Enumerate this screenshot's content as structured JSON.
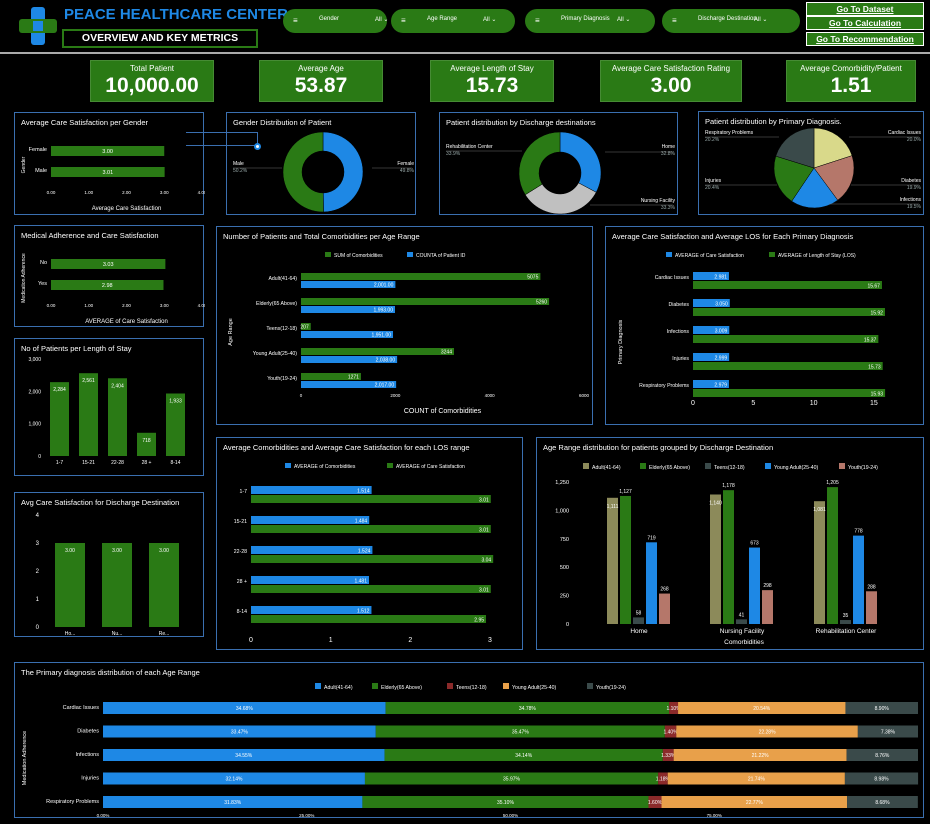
{
  "header": {
    "title": "PEACE HEALTHCARE CENTER",
    "subtitle": "OVERVIEW AND KEY METRICS",
    "filters": [
      {
        "label": "Gender",
        "value": "All"
      },
      {
        "label": "Age Range",
        "value": "All"
      },
      {
        "label": "Primary Diagnosis",
        "value": "All"
      },
      {
        "label": "Discharge Destination",
        "value": "All"
      }
    ],
    "nav": [
      "Go To Dataset",
      "Go To Calculation",
      "Go To Recommendation"
    ]
  },
  "kpis": [
    {
      "label": "Total Patient",
      "value": "10,000.00"
    },
    {
      "label": "Average Age",
      "value": "53.87"
    },
    {
      "label": "Average Length of Stay",
      "value": "15.73"
    },
    {
      "label": "Average Care Satisfaction Rating",
      "value": "3.00"
    },
    {
      "label": "Average Comorbidity/Patient",
      "value": "1.51"
    }
  ],
  "colors": {
    "green": "#2a7a15",
    "blue": "#1e88e5",
    "grey": "#c0c0c0",
    "olive": "#8c8a5a",
    "darkslate": "#3a4a4a",
    "salmon": "#b5776a",
    "yellow": "#d9d98a",
    "maroon": "#8b2a2a",
    "orange": "#e8a04a"
  },
  "chart_data": [
    {
      "id": "c1",
      "type": "bar",
      "orientation": "horizontal",
      "title": "Average Care Satisfaction per Gender",
      "categories": [
        "Female",
        "Male"
      ],
      "values": [
        3.0,
        3.01
      ],
      "labels": [
        "3.00",
        "3.01"
      ],
      "xlabel": "Average Care Satisfaction",
      "ylabel": "Gender",
      "xlim": [
        0,
        4
      ],
      "ticks": [
        "0.00",
        "1.00",
        "2.00",
        "3.00",
        "4.00"
      ]
    },
    {
      "id": "c2",
      "type": "pie",
      "donut": true,
      "title": "Gender Distribution of Patient",
      "slices": [
        {
          "name": "Female",
          "value": 49.8,
          "pct": "49.8%"
        },
        {
          "name": "Male",
          "value": 50.2,
          "pct": "50.2%"
        }
      ]
    },
    {
      "id": "c3",
      "type": "pie",
      "donut": true,
      "title": "Patient distribution by Discharge destinations",
      "slices": [
        {
          "name": "Home",
          "value": 32.8,
          "pct": "32.8%"
        },
        {
          "name": "Nursing Facility",
          "value": 33.3,
          "pct": "33.3%"
        },
        {
          "name": "Rehabilitation Center",
          "value": 33.9,
          "pct": "33.9%"
        }
      ]
    },
    {
      "id": "c4",
      "type": "pie",
      "donut": false,
      "title": "Patient distribution by Primary Diagnosis.",
      "slices": [
        {
          "name": "Cardiac Issues",
          "value": 20.0,
          "pct": "20.0%"
        },
        {
          "name": "Diabetes",
          "value": 19.9,
          "pct": "19.9%"
        },
        {
          "name": "Infections",
          "value": 19.5,
          "pct": "19.5%"
        },
        {
          "name": "Injuries",
          "value": 20.4,
          "pct": "20.4%"
        },
        {
          "name": "Respiratory Problems",
          "value": 20.2,
          "pct": "20.2%"
        }
      ]
    },
    {
      "id": "c5",
      "type": "bar",
      "orientation": "horizontal",
      "title": "Medical Adherence and Care Satisfaction",
      "categories": [
        "No",
        "Yes"
      ],
      "values": [
        3.03,
        2.98
      ],
      "labels": [
        "3.03",
        "2.98"
      ],
      "xlabel": "AVERAGE of Care Satisfaction",
      "ylabel": "Medication Adherence",
      "xlim": [
        0,
        4
      ],
      "ticks": [
        "0.00",
        "1.00",
        "2.00",
        "3.00",
        "4.00"
      ]
    },
    {
      "id": "c6",
      "type": "bar",
      "orientation": "horizontal",
      "title": "Number of Patients and Total Comorbidities per Age Range",
      "categories": [
        "Adult(41-64)",
        "Elderly(65 Above)",
        "Teens(12-18)",
        "Young Adult(25-40)",
        "Youth(19-24)"
      ],
      "series": [
        {
          "name": "SUM of Comorbidities",
          "values": [
            5075,
            5260,
            207,
            3244,
            1271
          ],
          "labels": [
            "5075",
            "5260",
            "207",
            "3244",
            "1271"
          ]
        },
        {
          "name": "COUNTA of Patient ID",
          "values": [
            2001,
            1993,
            1951,
            2038,
            2017
          ],
          "labels": [
            "2,001.00",
            "1,993.00",
            "1,951.00",
            "2,038.00",
            "2,017.00"
          ]
        }
      ],
      "xlabel": "COUNT of Comorbidities",
      "ylabel": "Age Range",
      "xlim": [
        0,
        6000
      ],
      "ticks": [
        "0",
        "2000",
        "4000",
        "6000"
      ]
    },
    {
      "id": "c7",
      "type": "bar",
      "orientation": "horizontal",
      "title": "Average Care Satisfaction and Average LOS for Each Primary Diagnosis",
      "categories": [
        "Cardiac Issues",
        "Diabetes",
        "Infections",
        "Injuries",
        "Respiratory Problems"
      ],
      "series": [
        {
          "name": "AVERAGE of Care Satisfaction",
          "values": [
            2.981,
            3.05,
            3.009,
            2.999,
            2.979
          ],
          "labels": [
            "2.981",
            "3.050",
            "3.009",
            "2.999",
            "2.979"
          ]
        },
        {
          "name": "AVERAGE of Length of Stay (LOS)",
          "values": [
            15.67,
            15.92,
            15.37,
            15.73,
            15.93
          ],
          "labels": [
            "15.67",
            "15.92",
            "15.37",
            "15.73",
            "15.93"
          ]
        }
      ],
      "ylabel": "Primary Diagnosis",
      "xlim": [
        0,
        17
      ],
      "ticks": [
        "0",
        "5",
        "10",
        "15"
      ],
      "tickvals": [
        0,
        5,
        10,
        15
      ]
    },
    {
      "id": "c8",
      "type": "bar",
      "orientation": "vertical",
      "title": "No of Patients per Length of Stay",
      "categories": [
        "1-7",
        "15-21",
        "22-28",
        "28 +",
        "8-14"
      ],
      "values": [
        2284,
        2561,
        2404,
        718,
        1933
      ],
      "labels": [
        "2,284",
        "2,561",
        "2,404",
        "718",
        "1,933"
      ],
      "ylim": [
        0,
        3000
      ],
      "ticks": [
        "0",
        "1,000",
        "2,000",
        "3,000"
      ]
    },
    {
      "id": "c9",
      "type": "bar",
      "orientation": "vertical",
      "title": "Avg Care Satisfaction for Discharge Destination",
      "categories": [
        "Ho...",
        "Nu...",
        "Re..."
      ],
      "values": [
        3.0,
        3.0,
        3.0
      ],
      "labels": [
        "3.00",
        "3.00",
        "3.00"
      ],
      "ylim": [
        0,
        4
      ],
      "ticks": [
        "0",
        "1",
        "2",
        "3",
        "4"
      ]
    },
    {
      "id": "c10",
      "type": "bar",
      "orientation": "horizontal",
      "title": "Average Comorbidities and Average Care Satisfaction for each LOS range",
      "categories": [
        "1-7",
        "15-21",
        "22-28",
        "28 +",
        "8-14"
      ],
      "series": [
        {
          "name": "AVERAGE of Comorbidities",
          "values": [
            1.514,
            1.484,
            1.524,
            1.481,
            1.512
          ],
          "labels": [
            "1.514",
            "1.484",
            "1.524",
            "1.481",
            "1.512"
          ]
        },
        {
          "name": "AVERAGE of Care Satisfaction",
          "values": [
            3.01,
            3.01,
            3.04,
            3.01,
            2.95
          ],
          "labels": [
            "3.01",
            "3.01",
            "3.04",
            "3.01",
            "2.95"
          ]
        }
      ],
      "xlim": [
        0,
        3
      ],
      "ticks": [
        "0",
        "1",
        "2",
        "3"
      ]
    },
    {
      "id": "c11",
      "type": "bar",
      "orientation": "vertical",
      "title": "Age Range distribution for patients grouped by Discharge Destination",
      "categories": [
        "Home",
        "Nursing Facility",
        "Rehabilitation Center"
      ],
      "series": [
        {
          "name": "Adult(41-64)",
          "values": [
            1111,
            1140,
            1081
          ],
          "labels": [
            "1,111",
            "1,140",
            "1,081"
          ]
        },
        {
          "name": "Elderly(65 Above)",
          "values": [
            1127,
            1178,
            1205
          ],
          "labels": [
            "1,127",
            "1,178",
            "1,205"
          ]
        },
        {
          "name": "Teens(12-18)",
          "values": [
            58,
            41,
            35
          ],
          "labels": [
            "58",
            "41",
            "35"
          ]
        },
        {
          "name": "Young Adult(25-40)",
          "values": [
            719,
            673,
            778
          ],
          "labels": [
            "719",
            "673",
            "778"
          ]
        },
        {
          "name": "Youth(19-24)",
          "values": [
            268,
            298,
            288
          ],
          "labels": [
            "268",
            "298",
            "288"
          ]
        }
      ],
      "xlabel": "Comorbidities",
      "ylim": [
        0,
        1250
      ],
      "ticks": [
        "0",
        "250",
        "500",
        "750",
        "1,000",
        "1,250"
      ]
    },
    {
      "id": "c12",
      "type": "bar",
      "orientation": "horizontal",
      "stacked": "percent",
      "title": "The Primary diagnosis distribution of each Age Range",
      "categories": [
        "Cardiac Issues",
        "Diabetes",
        "Infections",
        "Injuries",
        "Respiratory Problems"
      ],
      "series": [
        {
          "name": "Adult(41-64)",
          "values": [
            34.68,
            33.47,
            34.55,
            32.14,
            31.83
          ],
          "labels": [
            "34.68%",
            "33.47%",
            "34.55%",
            "32.14%",
            "31.83%"
          ]
        },
        {
          "name": "Elderly(65 Above)",
          "values": [
            34.78,
            35.47,
            34.14,
            35.97,
            35.1
          ],
          "labels": [
            "34.78%",
            "35.47%",
            "34.14%",
            "35.97%",
            "35.10%"
          ]
        },
        {
          "name": "Teens(12-18)",
          "values": [
            1.1,
            1.4,
            1.33,
            1.18,
            1.6
          ],
          "labels": [
            "1.10%",
            "1.40%",
            "1.33%",
            "1.18%",
            "1.60%"
          ]
        },
        {
          "name": "Young Adult(25-40)",
          "values": [
            20.54,
            22.28,
            21.22,
            21.74,
            22.77
          ],
          "labels": [
            "20.54%",
            "22.28%",
            "21.22%",
            "21.74%",
            "22.77%"
          ]
        },
        {
          "name": "Youth(19-24)",
          "values": [
            8.9,
            7.38,
            8.76,
            8.98,
            8.68
          ],
          "labels": [
            "8.90%",
            "7.38%",
            "8.76%",
            "8.98%",
            "8.68%"
          ]
        }
      ],
      "ylabel": "Medication Adherence",
      "xlim": [
        0,
        100
      ],
      "ticks": [
        "0.00%",
        "25.00%",
        "50.00%",
        "75.00%"
      ]
    }
  ]
}
